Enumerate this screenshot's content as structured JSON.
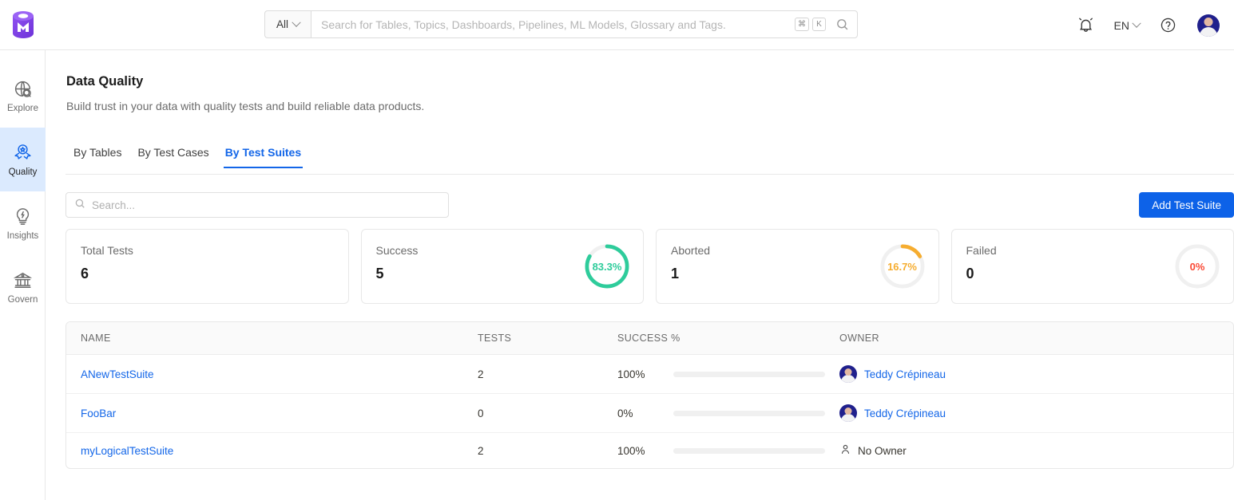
{
  "topbar": {
    "logo_icon": "openmetadata-cylinder-logo",
    "scope_label": "All",
    "scope_chevron_icon": "chevron-down-icon",
    "search_placeholder": "Search for Tables, Topics, Dashboards, Pipelines, ML Models, Glossary and Tags.",
    "search_value": "",
    "kbd_cmd": "⌘",
    "kbd_key": "K",
    "search_icon": "search-icon",
    "bell_icon": "notification-bell-icon",
    "language_label": "EN",
    "language_chevron_icon": "chevron-down-icon",
    "help_icon": "help-circle-icon",
    "avatar_icon": "user-avatar"
  },
  "sidebar": {
    "items": [
      {
        "label": "Explore",
        "icon": "globe-search-icon",
        "active": false
      },
      {
        "label": "Quality",
        "icon": "quality-award-icon",
        "active": true
      },
      {
        "label": "Insights",
        "icon": "lightbulb-icon",
        "active": false
      },
      {
        "label": "Govern",
        "icon": "bank-classical-icon",
        "active": false
      }
    ]
  },
  "page": {
    "title": "Data Quality",
    "subtitle": "Build trust in your data with quality tests and build reliable data products."
  },
  "tabs": [
    {
      "label": "By Tables",
      "active": false
    },
    {
      "label": "By Test Cases",
      "active": false
    },
    {
      "label": "By Test Suites",
      "active": true
    }
  ],
  "toolbar": {
    "search_placeholder": "Search...",
    "search_value": "",
    "search_icon": "search-icon",
    "add_label": "Add Test Suite"
  },
  "colors": {
    "accent_blue": "#0d62e8",
    "link_blue": "#1366e8",
    "success_green": "#2ecc9b",
    "aborted_orange": "#f6ad30",
    "failed_red": "#fa4a36",
    "track_gray": "#f0f0f0"
  },
  "chart_data": {
    "type": "pie",
    "title": "Test Suite Summary",
    "cards": [
      {
        "label": "Total Tests",
        "value": "6",
        "percent": null,
        "percent_num": null,
        "color": null,
        "has_donut": false
      },
      {
        "label": "Success",
        "value": "5",
        "percent": "83.3%",
        "percent_num": 83.3,
        "color": "#2ecc9b",
        "has_donut": true
      },
      {
        "label": "Aborted",
        "value": "1",
        "percent": "16.7%",
        "percent_num": 16.7,
        "color": "#f6ad30",
        "has_donut": true
      },
      {
        "label": "Failed",
        "value": "0",
        "percent": "0%",
        "percent_num": 0,
        "color": "#fa4a36",
        "has_donut": true
      }
    ]
  },
  "table": {
    "columns": [
      "NAME",
      "TESTS",
      "SUCCESS %",
      "OWNER"
    ],
    "rows": [
      {
        "name": "ANewTestSuite",
        "tests": "2",
        "success_pct": "100%",
        "success_num": 100,
        "owner": "Teddy Crépineau",
        "owner_icon": "user-avatar",
        "has_owner": true
      },
      {
        "name": "FooBar",
        "tests": "0",
        "success_pct": "0%",
        "success_num": 0,
        "owner": "Teddy Crépineau",
        "owner_icon": "user-avatar",
        "has_owner": true
      },
      {
        "name": "myLogicalTestSuite",
        "tests": "2",
        "success_pct": "100%",
        "success_num": 100,
        "owner": "No Owner",
        "owner_icon": "user-outline-icon",
        "has_owner": false
      }
    ]
  }
}
